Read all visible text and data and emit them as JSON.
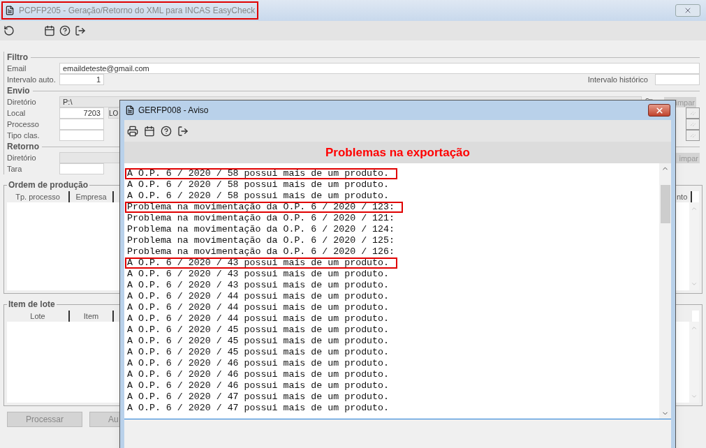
{
  "window": {
    "title": "PCPFP205 - Geração/Retorno do XML para INCAS EasyCheck",
    "highlighted": true
  },
  "filtro": {
    "legend": "Filtro",
    "email_label": "Email",
    "email_value": "emaildeteste@gmail.com",
    "intervalo_auto_label": "Intervalo auto.",
    "intervalo_auto_value": "1",
    "intervalo_historico_label": "Intervalo histórico"
  },
  "envio": {
    "legend": "Envio",
    "diretorio_label": "Diretório",
    "diretorio_value": "P:\\",
    "local_label": "Local",
    "local_value": "7203",
    "local_name": "LO",
    "processo_label": "Processo",
    "tipo_clas_label": "Tipo clas.",
    "button": "impar"
  },
  "retorno": {
    "legend": "Retorno",
    "diretorio_label": "Diretório",
    "tara_label": "Tara",
    "button": "impar"
  },
  "ordem": {
    "legend": "Ordem de produção",
    "columns": [
      "Tp. processo",
      "Empresa"
    ],
    "column_last": "nto"
  },
  "item_lote": {
    "legend": "Item de lote",
    "columns": [
      "Lote",
      "Item"
    ]
  },
  "buttons": [
    {
      "label": "Processar",
      "disabled": true
    },
    {
      "label": "Au",
      "disabled": true
    }
  ],
  "dialog": {
    "title": "GERFP008 - Aviso",
    "heading": "Problemas na exportação",
    "lines": [
      {
        "text": "A O.P. 6 / 2020 / 58 possui mais de um produto.",
        "highlighted": true
      },
      {
        "text": "A O.P. 6 / 2020 / 58 possui mais de um produto.",
        "highlighted": false
      },
      {
        "text": "A O.P. 6 / 2020 / 58 possui mais de um produto.",
        "highlighted": false
      },
      {
        "text": "Problema na movimentação da O.P. 6 / 2020 / 123:",
        "highlighted": true
      },
      {
        "text": "Problema na movimentação da O.P. 6 / 2020 / 121:",
        "highlighted": false
      },
      {
        "text": "Problema na movimentação da O.P. 6 / 2020 / 124:",
        "highlighted": false
      },
      {
        "text": "Problema na movimentação da O.P. 6 / 2020 / 125:",
        "highlighted": false
      },
      {
        "text": "Problema na movimentação da O.P. 6 / 2020 / 126:",
        "highlighted": false
      },
      {
        "text": "A O.P. 6 / 2020 / 43 possui mais de um produto.",
        "highlighted": true
      },
      {
        "text": "A O.P. 6 / 2020 / 43 possui mais de um produto.",
        "highlighted": false
      },
      {
        "text": "A O.P. 6 / 2020 / 43 possui mais de um produto.",
        "highlighted": false
      },
      {
        "text": "A O.P. 6 / 2020 / 44 possui mais de um produto.",
        "highlighted": false
      },
      {
        "text": "A O.P. 6 / 2020 / 44 possui mais de um produto.",
        "highlighted": false
      },
      {
        "text": "A O.P. 6 / 2020 / 44 possui mais de um produto.",
        "highlighted": false
      },
      {
        "text": "A O.P. 6 / 2020 / 45 possui mais de um produto.",
        "highlighted": false
      },
      {
        "text": "A O.P. 6 / 2020 / 45 possui mais de um produto.",
        "highlighted": false
      },
      {
        "text": "A O.P. 6 / 2020 / 45 possui mais de um produto.",
        "highlighted": false
      },
      {
        "text": "A O.P. 6 / 2020 / 46 possui mais de um produto.",
        "highlighted": false
      },
      {
        "text": "A O.P. 6 / 2020 / 46 possui mais de um produto.",
        "highlighted": false
      },
      {
        "text": "A O.P. 6 / 2020 / 46 possui mais de um produto.",
        "highlighted": false
      },
      {
        "text": "A O.P. 6 / 2020 / 47 possui mais de um produto.",
        "highlighted": false
      },
      {
        "text": "A O.P. 6 / 2020 / 47 possui mais de um produto.",
        "highlighted": false
      }
    ]
  }
}
